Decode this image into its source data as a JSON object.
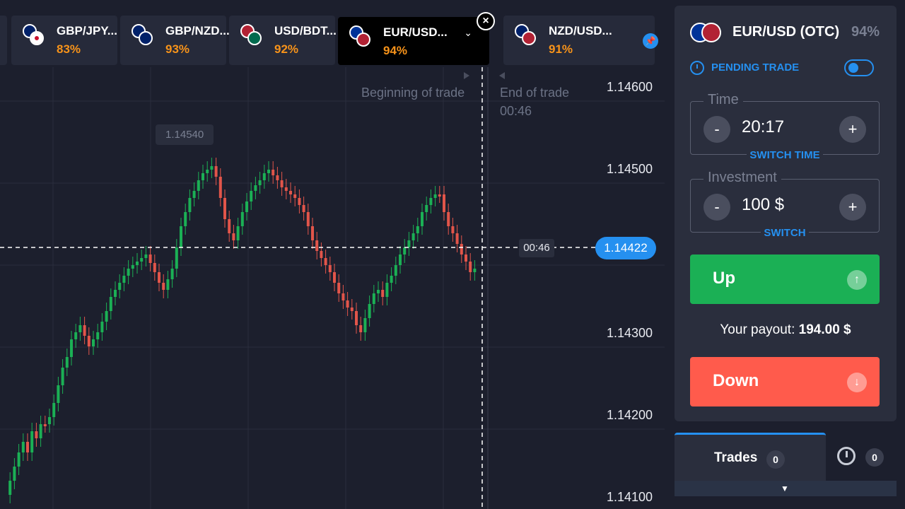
{
  "tabs": [
    {
      "name": "GBP/JPY...",
      "pct": "83%",
      "flag1": "#c8102e",
      "flag2": "#ffffff"
    },
    {
      "name": "GBP/NZD...",
      "pct": "93%",
      "flag1": "#c8102e",
      "flag2": "#012169"
    },
    {
      "name": "USD/BDT...",
      "pct": "92%",
      "flag1": "#b22234",
      "flag2": "#006a4e"
    },
    {
      "name": "EUR/USD...",
      "pct": "94%",
      "flag1": "#003399",
      "flag2": "#b22234",
      "active": true
    },
    {
      "name": "NZD/USD...",
      "pct": "91%",
      "flag1": "#012169",
      "flag2": "#b22234"
    }
  ],
  "close_symbol": "×",
  "pin_symbol": "📌",
  "chevron_symbol": "⌄",
  "chart": {
    "beginning_label": "Beginning of trade",
    "end_label": "End of trade",
    "end_countdown": "00:46",
    "hover_price": "1.14540",
    "current_price": "1.14422",
    "current_time_badge": "00:46",
    "price_levels": [
      "1.14600",
      "1.14500",
      "1.14300",
      "1.14200",
      "1.14100"
    ],
    "colors": {
      "up": "#1bb055",
      "down": "#e2554a",
      "grid": "#2a2e3d",
      "bg": "#1c1f2d"
    }
  },
  "panel": {
    "asset_title": "EUR/USD (OTC)",
    "asset_pct": "94%",
    "pending_label": "PENDING TRADE",
    "time_legend": "Time",
    "time_value": "20:17",
    "switch_time": "SWITCH TIME",
    "investment_legend": "Investment",
    "investment_value": "100 $",
    "switch_label": "SWITCH",
    "minus": "-",
    "plus": "+",
    "up_label": "Up",
    "up_arrow": "↑",
    "payout_label": "Your payout:",
    "payout_value": "194.00 $",
    "down_label": "Down",
    "down_arrow": "↓"
  },
  "bottom": {
    "trades_label": "Trades",
    "trades_count": "0",
    "history_count": "0",
    "expand_arrow": "▼"
  }
}
